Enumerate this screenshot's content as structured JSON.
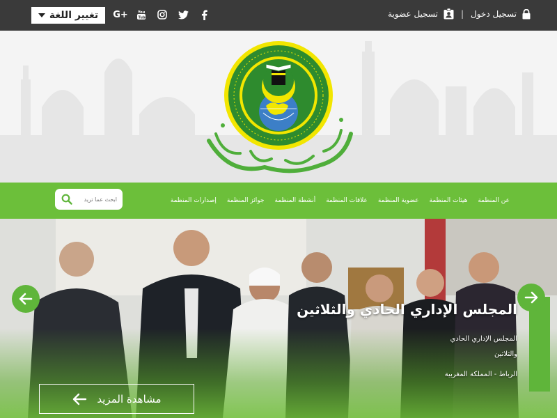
{
  "topbar": {
    "language_label": "تغيير اللغة",
    "social": [
      {
        "name": "google-plus-icon",
        "glyph": "G+"
      },
      {
        "name": "youtube-icon",
        "glyph": "You"
      },
      {
        "name": "instagram-icon",
        "glyph": ""
      },
      {
        "name": "twitter-icon",
        "glyph": ""
      },
      {
        "name": "facebook-icon",
        "glyph": "f"
      }
    ],
    "login_label": "تسجيل دخول",
    "register_label": "تسجيل عضوية",
    "separator": "|"
  },
  "nav": {
    "items": [
      "عن المنظمة",
      "هيئات المنظمة",
      "عضوية المنظمة",
      "علاقات المنظمة",
      "أنشطة المنظمة",
      "جوائز المنظمة",
      "إصدارات المنظمة"
    ],
    "search_placeholder": "ابحث عما تريد"
  },
  "hero": {
    "title": "المجلس الإداري الحادي والثلاثين",
    "description_line1": "المجلس الإداري الحادي",
    "description_line2": "والثلاثين",
    "location": "الرباط - المملكة المغربية",
    "more_label": "مشاهدة المزيد"
  },
  "colors": {
    "topbar": "#3a3a3a",
    "accent_green": "#6cbf3a",
    "arrow_green": "#5fb53a",
    "logo_yellow": "#f2e600",
    "logo_green": "#2e8b2e"
  }
}
